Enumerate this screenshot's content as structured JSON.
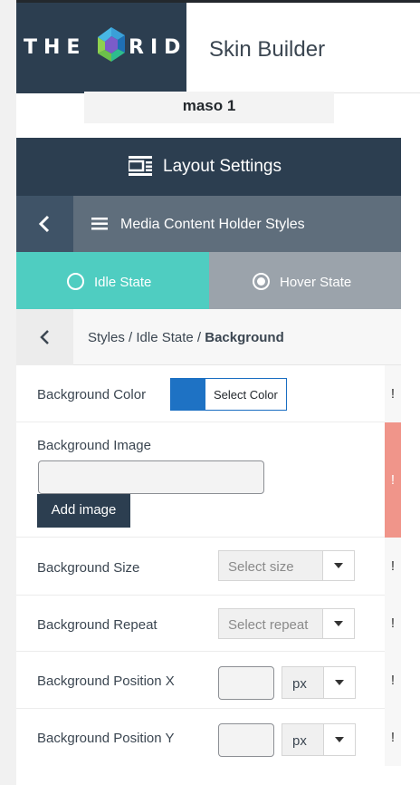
{
  "header": {
    "logo_left": "THE",
    "logo_right": "RID",
    "logo_alt": "THE GRID",
    "title": "Skin Builder"
  },
  "skin": {
    "name": "maso 1"
  },
  "layout": {
    "label": "Layout Settings"
  },
  "section": {
    "label": "Media Content Holder Styles"
  },
  "states": {
    "idle_label": "Idle State",
    "hover_label": "Hover State",
    "active": "idle"
  },
  "breadcrumb": {
    "prefix": "Styles / Idle State / ",
    "current": "Background"
  },
  "fields": {
    "bg_color": {
      "label": "Background Color",
      "button": "Select Color",
      "value": "#1e72c4"
    },
    "bg_image": {
      "label": "Background Image",
      "value": "",
      "button": "Add image"
    },
    "bg_size": {
      "label": "Background Size",
      "placeholder": "Select size"
    },
    "bg_repeat": {
      "label": "Background Repeat",
      "placeholder": "Select repeat"
    },
    "bg_pos_x": {
      "label": "Background Position X",
      "value": "",
      "unit": "px"
    },
    "bg_pos_y": {
      "label": "Background Position Y",
      "value": "",
      "unit": "px"
    }
  },
  "important_marker": "!",
  "colors": {
    "dark": "#2c3e50",
    "slate": "#5f6e7c",
    "teal": "#4fcdc1",
    "grey_tab": "#9ba3ab",
    "alert": "#f0958a",
    "swatch": "#1e72c4"
  }
}
